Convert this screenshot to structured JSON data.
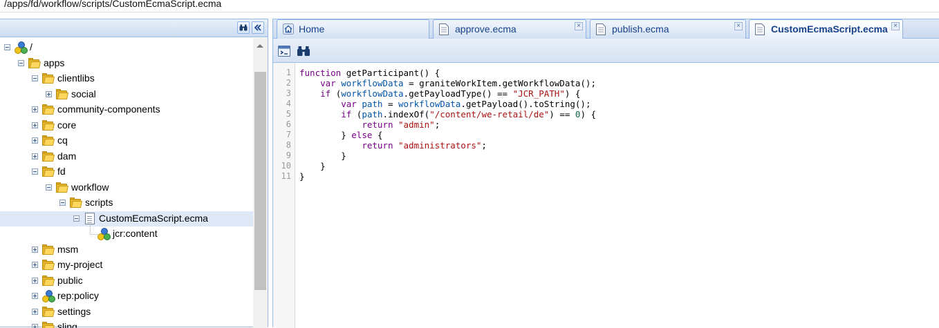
{
  "path_bar": {
    "text": "/apps/fd/workflow/scripts/CustomEcmaScript.ecma"
  },
  "colors": {
    "panel_border": "#99bbe8",
    "selected_row": "#dfe8f6",
    "tab_text": "#15428b",
    "folder": "#ffd75e"
  },
  "left_panel": {
    "header_buttons": [
      "binoculars-icon",
      "collapse-double-chevron-icon"
    ],
    "tree": [
      {
        "label": "/",
        "icon": "repository-root-icon",
        "level": 0,
        "toggle": "minus"
      },
      {
        "label": "apps",
        "icon": "folder-icon",
        "level": 1,
        "toggle": "minus"
      },
      {
        "label": "clientlibs",
        "icon": "folder-icon",
        "level": 2,
        "toggle": "minus"
      },
      {
        "label": "social",
        "icon": "folder-icon",
        "level": 3,
        "toggle": "plus"
      },
      {
        "label": "community-components",
        "icon": "folder-icon",
        "level": 2,
        "toggle": "plus"
      },
      {
        "label": "core",
        "icon": "folder-icon",
        "level": 2,
        "toggle": "plus"
      },
      {
        "label": "cq",
        "icon": "folder-icon",
        "level": 2,
        "toggle": "plus"
      },
      {
        "label": "dam",
        "icon": "folder-icon",
        "level": 2,
        "toggle": "plus"
      },
      {
        "label": "fd",
        "icon": "folder-icon",
        "level": 2,
        "toggle": "minus"
      },
      {
        "label": "workflow",
        "icon": "folder-icon",
        "level": 3,
        "toggle": "minus"
      },
      {
        "label": "scripts",
        "icon": "folder-icon",
        "level": 4,
        "toggle": "minus"
      },
      {
        "label": "CustomEcmaScript.ecma",
        "icon": "file-icon",
        "level": 5,
        "toggle": "minus",
        "selected": true
      },
      {
        "label": "jcr:content",
        "icon": "node-icon",
        "level": 6,
        "toggle": "none"
      },
      {
        "label": "msm",
        "icon": "folder-icon",
        "level": 2,
        "toggle": "plus"
      },
      {
        "label": "my-project",
        "icon": "folder-icon",
        "level": 2,
        "toggle": "plus"
      },
      {
        "label": "public",
        "icon": "folder-icon",
        "level": 2,
        "toggle": "plus"
      },
      {
        "label": "rep:policy",
        "icon": "node-icon",
        "level": 2,
        "toggle": "plus"
      },
      {
        "label": "settings",
        "icon": "folder-icon",
        "level": 2,
        "toggle": "plus"
      },
      {
        "label": "sling",
        "icon": "folder-icon",
        "level": 2,
        "toggle": "plus"
      }
    ]
  },
  "tabs": [
    {
      "label": "Home",
      "icon": "home-icon",
      "closable": false,
      "active": false
    },
    {
      "label": "approve.ecma",
      "icon": "document-icon",
      "closable": true,
      "active": false
    },
    {
      "label": "publish.ecma",
      "icon": "document-icon",
      "closable": true,
      "active": false
    },
    {
      "label": "CustomEcmaScript.ecma",
      "icon": "document-icon",
      "closable": true,
      "active": true
    }
  ],
  "editor_toolbar": [
    "format-code-icon",
    "binoculars-icon"
  ],
  "editor": {
    "line_numbers": [
      "1",
      "2",
      "3",
      "4",
      "5",
      "6",
      "7",
      "8",
      "9",
      "10",
      "11"
    ],
    "code_lines": [
      "function getParticipant() {",
      "    var workflowData = graniteWorkItem.getWorkflowData();",
      "    if (workflowData.getPayloadType() == \"JCR_PATH\") {",
      "        var path = workflowData.getPayload().toString();",
      "        if (path.indexOf(\"/content/we-retail/de\") == 0) {",
      "            return \"admin\";",
      "        } else {",
      "            return \"administrators\";",
      "        }",
      "    }",
      "}"
    ]
  }
}
